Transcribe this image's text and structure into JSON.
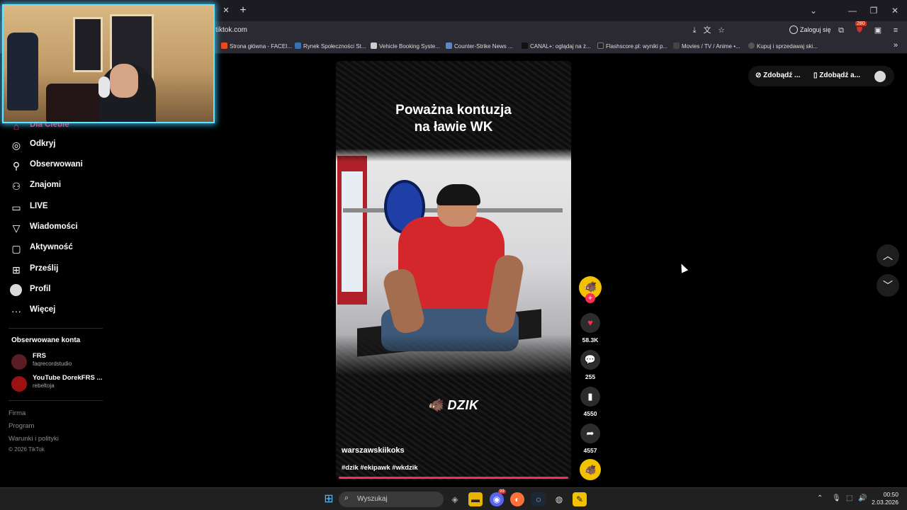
{
  "browser": {
    "url": "tiktok.com",
    "login_label": "Zaloguj się",
    "extension_badge": "280",
    "bookmarks": [
      {
        "label": "Strona główna - FACEI...",
        "color": "#e84a1c"
      },
      {
        "label": "Rynek Społeczności St...",
        "color": "#3a6fb0"
      },
      {
        "label": "Vehicle Booking Syste...",
        "color": "#cccccc"
      },
      {
        "label": "Counter-Strike News ...",
        "color": "#5a8ac6"
      },
      {
        "label": "CANAL+: oglądaj na ż...",
        "color": "#111111"
      },
      {
        "label": "Flashscore.pl: wyniki p...",
        "color": "#222222"
      },
      {
        "label": "Movies / TV / Anime •...",
        "color": "#444444"
      },
      {
        "label": "Kupuj i sprzedawaj ski...",
        "color": "#555555"
      }
    ]
  },
  "sidebar": {
    "items": [
      {
        "label": "Dla Ciebie",
        "icon": "home-icon"
      },
      {
        "label": "Odkryj",
        "icon": "compass-icon"
      },
      {
        "label": "Obserwowani",
        "icon": "following-icon"
      },
      {
        "label": "Znajomi",
        "icon": "friends-icon"
      },
      {
        "label": "LIVE",
        "icon": "live-icon"
      },
      {
        "label": "Wiadomości",
        "icon": "messages-icon"
      },
      {
        "label": "Aktywność",
        "icon": "activity-icon"
      },
      {
        "label": "Prześlij",
        "icon": "upload-icon"
      },
      {
        "label": "Profil",
        "icon": "profile-icon"
      },
      {
        "label": "Więcej",
        "icon": "more-icon"
      }
    ],
    "followed_title": "Obserwowane konta",
    "followed": [
      {
        "name": "FRS",
        "handle": "faqrecordstudio",
        "color": "#5a1d24"
      },
      {
        "name": "YouTube DorekFRS ...",
        "handle": "rebeltoja",
        "color": "#9c1212"
      }
    ],
    "footer": [
      "Firma",
      "Program",
      "Warunki i polityki"
    ],
    "copyright": "© 2026 TikTok"
  },
  "video": {
    "title_line1": "Poważna kontuzja",
    "title_line2": "na ławie WK",
    "brand": "DZIK",
    "author": "warszawskiikoks",
    "tags": "#dzik #ekipawk #wkdzik"
  },
  "actions": {
    "likes": "58.3K",
    "comments": "255",
    "saves": "4550",
    "shares": "4557"
  },
  "top_right": {
    "item1": "Zdobądź ...",
    "item2": "Zdobądź a..."
  },
  "taskbar": {
    "search_placeholder": "Wyszukaj",
    "time": "00:50",
    "date": "2.03.2026",
    "notif_badge": "99"
  },
  "colors": {
    "accent": "#fe2c55",
    "cam_border": "#5fe6ff",
    "avatar_yellow": "#f2c200"
  }
}
